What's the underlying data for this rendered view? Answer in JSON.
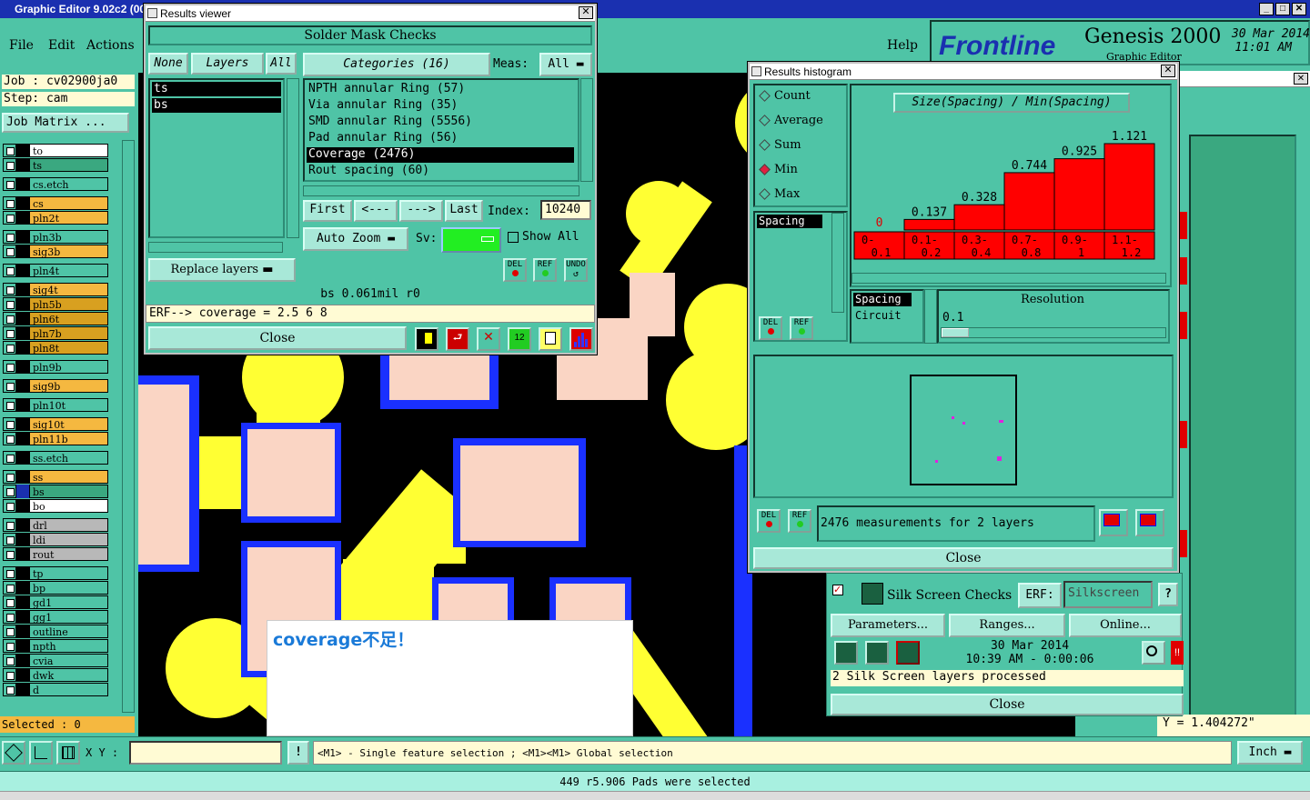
{
  "app": {
    "title": "Graphic Editor 9.02c2 (00",
    "menu": [
      "File",
      "Edit",
      "Actions"
    ],
    "help": "Help",
    "brand": "Frontline",
    "product": "Genesis 2000",
    "product_sub": "Graphic Editor",
    "date": "30 Mar 2014",
    "time": "11:01 AM"
  },
  "left": {
    "job": "Job : cv02900ja0",
    "step": "Step: cam",
    "job_matrix": "Job Matrix ...",
    "selected": "Selected : 0",
    "layers": [
      {
        "name": "to",
        "color": "#ffffff",
        "sw": "#000"
      },
      {
        "name": "ts",
        "color": "#3aa880",
        "sw": "#000"
      },
      {
        "name": "cs.etch",
        "color": "#4fc4a6",
        "sw": "#000"
      },
      {
        "name": "cs",
        "color": "#f5b840",
        "sw": "#000"
      },
      {
        "name": "pln2t",
        "color": "#f5b840",
        "sw": "#000"
      },
      {
        "name": "pln3b",
        "color": "#4fc4a6",
        "sw": "#000"
      },
      {
        "name": "sig3b",
        "color": "#f5b840",
        "sw": "#000"
      },
      {
        "name": "pln4t",
        "color": "#4fc4a6",
        "sw": "#000"
      },
      {
        "name": "sig4t",
        "color": "#f5b840",
        "sw": "#000"
      },
      {
        "name": "pln5b",
        "color": "#d8a020",
        "sw": "#000"
      },
      {
        "name": "pln6t",
        "color": "#d8a020",
        "sw": "#000"
      },
      {
        "name": "pln7b",
        "color": "#d8a020",
        "sw": "#000"
      },
      {
        "name": "pln8t",
        "color": "#d8a020",
        "sw": "#000"
      },
      {
        "name": "pln9b",
        "color": "#4fc4a6",
        "sw": "#000"
      },
      {
        "name": "sig9b",
        "color": "#f5b840",
        "sw": "#000"
      },
      {
        "name": "pln10t",
        "color": "#4fc4a6",
        "sw": "#000"
      },
      {
        "name": "sig10t",
        "color": "#f5b840",
        "sw": "#000"
      },
      {
        "name": "pln11b",
        "color": "#f5b840",
        "sw": "#000"
      },
      {
        "name": "ss.etch",
        "color": "#4fc4a6",
        "sw": "#000"
      },
      {
        "name": "ss",
        "color": "#f5b840",
        "sw": "#000"
      },
      {
        "name": "bs",
        "color": "#3aa880",
        "sw": "#1a30b0"
      },
      {
        "name": "bo",
        "color": "#ffffff",
        "sw": "#000"
      },
      {
        "name": "drl",
        "color": "#b8b8b8",
        "sw": "#000"
      },
      {
        "name": "ldi",
        "color": "#b8b8b8",
        "sw": "#000"
      },
      {
        "name": "rout",
        "color": "#b8b8b8",
        "sw": "#000"
      },
      {
        "name": "tp",
        "color": "#4fc4a6",
        "sw": "#000"
      },
      {
        "name": "bp",
        "color": "#4fc4a6",
        "sw": "#000"
      },
      {
        "name": "gd1",
        "color": "#4fc4a6",
        "sw": "#000"
      },
      {
        "name": "gg1",
        "color": "#4fc4a6",
        "sw": "#000"
      },
      {
        "name": "outline",
        "color": "#4fc4a6",
        "sw": "#000"
      },
      {
        "name": "npth",
        "color": "#4fc4a6",
        "sw": "#000"
      },
      {
        "name": "cvia",
        "color": "#4fc4a6",
        "sw": "#000"
      },
      {
        "name": "dwk",
        "color": "#4fc4a6",
        "sw": "#000"
      },
      {
        "name": "d",
        "color": "#4fc4a6",
        "sw": "#000"
      }
    ]
  },
  "results_viewer": {
    "title": "Results viewer",
    "heading": "Solder Mask Checks",
    "none": "None",
    "layers_tab": "Layers",
    "all": "All",
    "layer_list": [
      "ts",
      "bs"
    ],
    "categories": "Categories (16)",
    "meas_label": "Meas:",
    "meas_value": "All",
    "items": [
      "NPTH annular Ring (57)",
      "Via annular Ring (35)",
      "SMD annular Ring (5556)",
      "Pad annular Ring (56)",
      "Coverage (2476)",
      "Rout spacing (60)"
    ],
    "first": "First",
    "prev": "<---",
    "next": "--->",
    "last": "Last",
    "index_label": "Index:",
    "index_value": "10240",
    "auto_zoom": "Auto Zoom",
    "sv_label": "Sv:",
    "show_all": "Show All",
    "replace_layers": "Replace layers",
    "status": "bs 0.061mil  r0",
    "erf": "ERF--> coverage = 2.5 6 8",
    "close": "Close",
    "del": "DEL",
    "ref": "REF",
    "undo": "UNDO"
  },
  "histogram": {
    "title": "Results histogram",
    "options": [
      "Count",
      "Average",
      "Sum",
      "Min",
      "Max"
    ],
    "selected": "Min",
    "chart_title": "Size(Spacing) / Min(Spacing)",
    "list1": [
      "Spacing"
    ],
    "list2": [
      "Spacing",
      "Circuit"
    ],
    "resolution_label": "Resolution",
    "resolution_value": "0.1",
    "measurements": "2476 measurements for 2 layers",
    "close": "Close",
    "del": "DEL",
    "ref": "REF"
  },
  "chart_data": {
    "type": "bar",
    "title": "Size(Spacing) / Min(Spacing)",
    "categories": [
      "0-\n0.1",
      "0.1-\n0.2",
      "0.3-\n0.4",
      "0.7-\n0.8",
      "0.9-\n1",
      "1.1-\n1.2"
    ],
    "values": [
      0,
      0.137,
      0.328,
      0.744,
      0.925,
      1.121
    ],
    "value_labels": [
      "0",
      "0.137",
      "0.328",
      "0.744",
      "0.925",
      "1.121"
    ],
    "bar_color": "#ff0000"
  },
  "silk": {
    "name": "Silk Screen Checks",
    "erf_label": "ERF:",
    "erf_value": "Silkscreen",
    "help": "?",
    "parameters": "Parameters...",
    "ranges": "Ranges...",
    "online": "Online...",
    "date": "30 Mar 2014",
    "time": "10:39 AM - 0:00:06",
    "status": "2 Silk Screen layers processed",
    "close": "Close",
    "bang": "!!"
  },
  "bottom": {
    "xy_label": "X Y :",
    "message": "<M1> - Single feature selection ; <M1><M1> Global selection",
    "unit": "Inch",
    "status": "449 r5.906 Pads were selected",
    "y_readout": "Y = 1.404272\""
  },
  "popup": {
    "text": "coverage不足！"
  }
}
